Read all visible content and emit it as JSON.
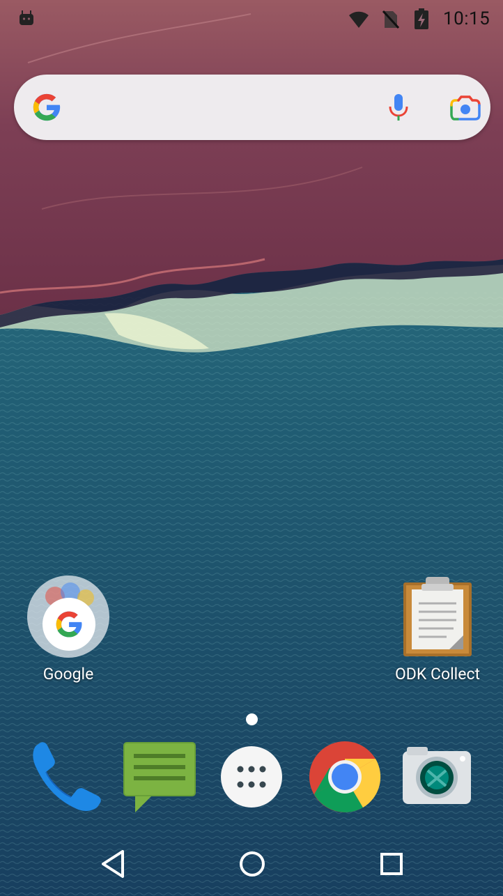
{
  "status_bar": {
    "time": "10:15",
    "icons": [
      "android-icon",
      "wifi-icon",
      "no-sim-signal-icon",
      "battery-charging-icon"
    ]
  },
  "search_bar": {
    "icons": [
      "google-g-icon",
      "microphone-icon",
      "google-lens-icon"
    ]
  },
  "home_apps": [
    {
      "label": "Google",
      "icon": "google-folder-icon"
    },
    {
      "label": "ODK Collect",
      "icon": "clipboard-icon"
    }
  ],
  "page_indicator": {
    "pages": 1,
    "current": 1
  },
  "dock": [
    {
      "name": "Phone",
      "icon": "phone-icon"
    },
    {
      "name": "Messages",
      "icon": "messages-icon"
    },
    {
      "name": "All apps",
      "icon": "app-drawer-icon"
    },
    {
      "name": "Chrome",
      "icon": "chrome-icon"
    },
    {
      "name": "Camera",
      "icon": "camera-icon"
    }
  ],
  "nav_bar": {
    "buttons": [
      "back-icon",
      "home-icon",
      "recents-icon"
    ]
  },
  "colors": {
    "wallpaper_top": "#7a3f55",
    "wallpaper_sea": "#1f5a6e",
    "search_bg": "#eeebee",
    "google_blue": "#4285f4",
    "google_red": "#ea4335",
    "google_yellow": "#fbbc05",
    "google_green": "#34a853"
  }
}
